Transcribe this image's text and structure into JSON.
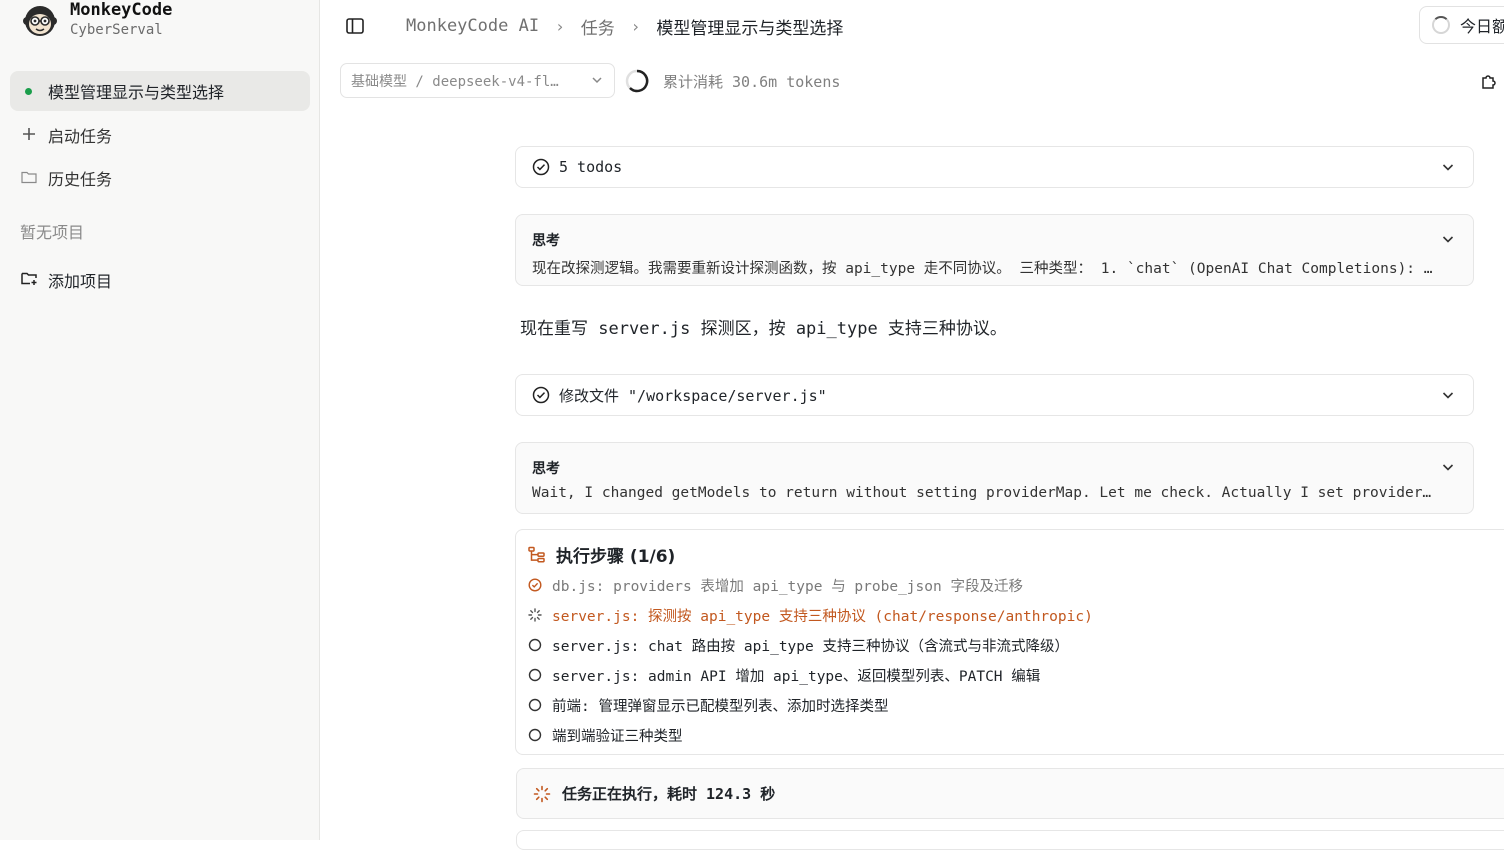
{
  "app": {
    "name": "MonkeyCode",
    "workspace": "CyberServal"
  },
  "sidebar": {
    "active_task": "模型管理显示与类型选择",
    "items": [
      {
        "label": "启动任务",
        "icon": "plus-icon"
      },
      {
        "label": "历史任务",
        "icon": "folder-icon"
      }
    ],
    "empty_projects": "暂无项目",
    "add_project": "添加项目"
  },
  "header": {
    "breadcrumbs": [
      "MonkeyCode AI",
      "任务",
      "模型管理显示与类型选择"
    ],
    "today_button": "今日额"
  },
  "toolbar": {
    "model_select": "基础模型 / deepseek-v4-fl…",
    "usage": "累计消耗 30.6m tokens"
  },
  "conversation": {
    "todos_label": "5 todos",
    "think1": {
      "title": "思考",
      "text": "现在改探测逻辑。我需要重新设计探测函数，按 api_type 走不同协议。 三种类型： 1. `chat` (OpenAI Chat Completions): …"
    },
    "message": "现在重写 server.js 探测区，按 api_type 支持三种协议。",
    "edit_file": "修改文件 \"/workspace/server.js\"",
    "think2": {
      "title": "思考",
      "text": "Wait, I changed getModels to return without setting providerMap. Let me check. Actually I set provider…"
    }
  },
  "steps": {
    "title": "执行步骤 (1/6)",
    "items": [
      {
        "text": "db.js: providers 表增加 api_type 与 probe_json 字段及迁移",
        "state": "done"
      },
      {
        "text": "server.js: 探测按 api_type 支持三种协议 (chat/response/anthropic)",
        "state": "active"
      },
      {
        "text": "server.js: chat 路由按 api_type 支持三种协议（含流式与非流式降级）",
        "state": "pending"
      },
      {
        "text": "server.js: admin API 增加 api_type、返回模型列表、PATCH 编辑",
        "state": "pending"
      },
      {
        "text": "前端: 管理弹窗显示已配模型列表、添加时选择类型",
        "state": "pending"
      },
      {
        "text": "端到端验证三种类型",
        "state": "pending"
      }
    ]
  },
  "status": {
    "text": "任务正在执行，耗时 124.3 秒"
  },
  "colors": {
    "accent": "#c2581f",
    "active_dot": "#1a9e4b"
  }
}
